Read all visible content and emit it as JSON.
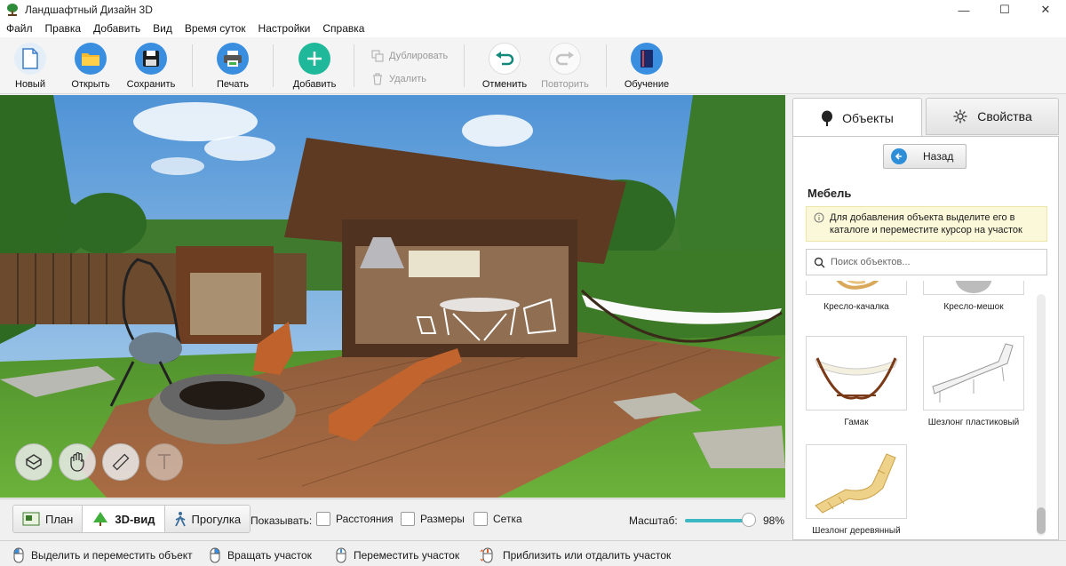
{
  "window": {
    "title": "Ландшафтный Дизайн 3D",
    "minimize": "—",
    "maximize": "☐",
    "close": "✕"
  },
  "menu": [
    "Файл",
    "Правка",
    "Добавить",
    "Вид",
    "Время суток",
    "Настройки",
    "Справка"
  ],
  "toolbar": {
    "new": "Новый",
    "open": "Открыть",
    "save": "Сохранить",
    "print": "Печать",
    "add": "Добавить",
    "duplicate": "Дублировать",
    "delete": "Удалить",
    "undo": "Отменить",
    "redo": "Повторить",
    "tutorial": "Обучение"
  },
  "viewport_tools": [
    "rotate-3d-icon",
    "hand-icon",
    "ruler-icon",
    "text-icon"
  ],
  "view_tabs": {
    "plan": "План",
    "view3d": "3D-вид",
    "walk": "Прогулка"
  },
  "show": {
    "label": "Показывать:",
    "distances": "Расстояния",
    "sizes": "Размеры",
    "grid": "Сетка"
  },
  "zoom": {
    "label": "Масштаб:",
    "value": "98%",
    "fraction": 0.98
  },
  "status": {
    "select_move": "Выделить и переместить объект",
    "rotate": "Вращать участок",
    "move": "Переместить участок",
    "zoom": "Приблизить или отдалить участок"
  },
  "panel": {
    "tab_objects": "Объекты",
    "tab_properties": "Свойства",
    "back": "Назад",
    "category": "Мебель",
    "info": "Для добавления объекта выделите его в каталоге и переместите курсор на участок",
    "search_placeholder": "Поиск объектов...",
    "items": [
      {
        "name": "Кресло-качалка"
      },
      {
        "name": "Кресло-мешок"
      },
      {
        "name": "Гамак"
      },
      {
        "name": "Шезлонг пластиковый"
      },
      {
        "name": "Шезлонг деревянный"
      }
    ]
  },
  "colors": {
    "accent": "#2e8fd8",
    "add_green": "#1fb89a",
    "slider": "#3cb8c4",
    "info_bg": "#fbf8d9"
  }
}
